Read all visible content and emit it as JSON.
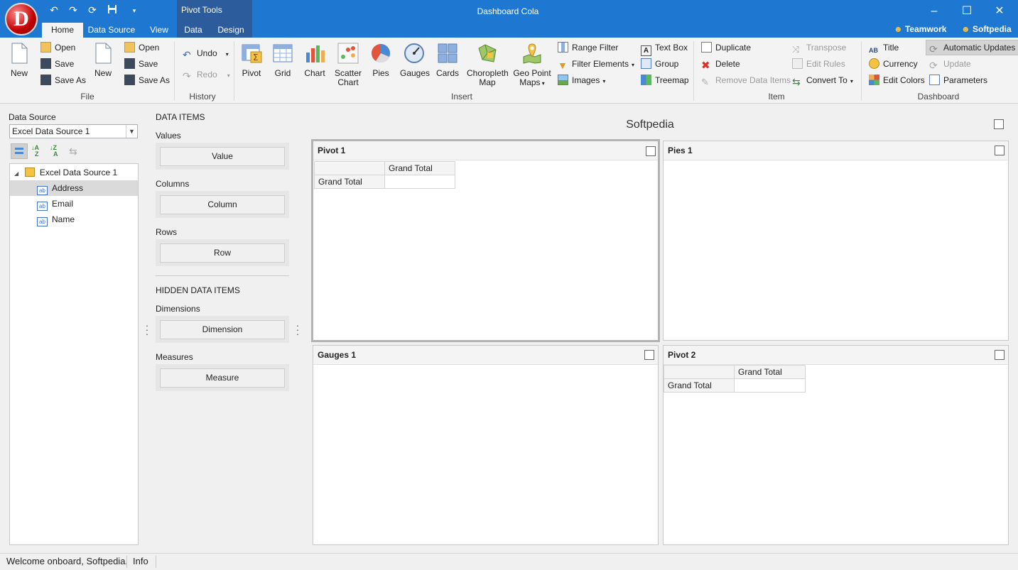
{
  "window": {
    "title": "Dashboard Cola",
    "context_group": "Pivot Tools",
    "tabs": [
      "Home",
      "Data Source",
      "View",
      "Data",
      "Design"
    ],
    "users": [
      "Teamwork",
      "Softpedia"
    ]
  },
  "ribbon": {
    "file": {
      "label": "File",
      "new1": "New",
      "open1": "Open",
      "save1": "Save",
      "saveas1": "Save As",
      "new2": "New",
      "open2": "Open",
      "save2": "Save",
      "saveas2": "Save As"
    },
    "history": {
      "label": "History",
      "undo": "Undo",
      "redo": "Redo"
    },
    "insert": {
      "label": "Insert",
      "pivot": "Pivot",
      "grid": "Grid",
      "chart": "Chart",
      "scatter_1": "Scatter",
      "scatter_2": "Chart",
      "pies": "Pies",
      "gauges": "Gauges",
      "cards": "Cards",
      "choropleth_1": "Choropleth",
      "choropleth_2": "Map",
      "geo_1": "Geo Point",
      "geo_2": "Maps",
      "range_filter": "Range Filter",
      "filter_elements": "Filter Elements",
      "images": "Images",
      "text_box": "Text Box",
      "group": "Group",
      "treemap": "Treemap"
    },
    "item": {
      "label": "Item",
      "duplicate": "Duplicate",
      "delete": "Delete",
      "remove_data_items": "Remove Data Items",
      "transpose": "Transpose",
      "edit_rules": "Edit Rules",
      "convert_to": "Convert To"
    },
    "dashboard": {
      "label": "Dashboard",
      "title": "Title",
      "currency": "Currency",
      "edit_colors": "Edit Colors",
      "automatic_updates": "Automatic Updates",
      "update": "Update",
      "parameters": "Parameters"
    }
  },
  "datasource": {
    "label": "Data Source",
    "selected": "Excel Data Source 1",
    "tree_root": "Excel Data Source 1",
    "fields": [
      "Address",
      "Email",
      "Name"
    ]
  },
  "data_items": {
    "header": "DATA ITEMS",
    "values_label": "Values",
    "values_btn": "Value",
    "columns_label": "Columns",
    "columns_btn": "Column",
    "rows_label": "Rows",
    "rows_btn": "Row",
    "hidden_header": "HIDDEN DATA ITEMS",
    "dimensions_label": "Dimensions",
    "dimensions_btn": "Dimension",
    "measures_label": "Measures",
    "measures_btn": "Measure"
  },
  "dashboard": {
    "title": "Softpedia",
    "panels": {
      "pivot1": {
        "title": "Pivot 1",
        "col_header": "Grand Total",
        "row_header": "Grand Total"
      },
      "pies1": {
        "title": "Pies 1"
      },
      "gauges1": {
        "title": "Gauges 1"
      },
      "pivot2": {
        "title": "Pivot 2",
        "col_header": "Grand Total",
        "row_header": "Grand Total"
      }
    }
  },
  "status": {
    "message": "Welcome onboard, Softpedia.",
    "info": "Info"
  },
  "colors": {
    "title_bar": "#1e78d2",
    "context_tab": "#2d5c9c",
    "ribbon": "#f3f3f3"
  }
}
